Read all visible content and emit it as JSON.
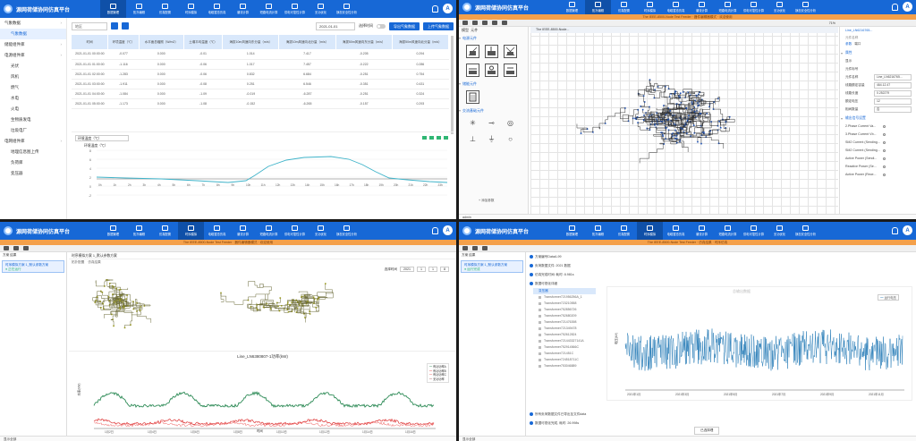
{
  "app": {
    "title": "源网荷储协同仿真平台",
    "avatar": "A",
    "nav": [
      "数据管理",
      "拓扑编辑",
      "仿真配置",
      "时序模拟",
      "电磁暂态仿真",
      "潮流计算",
      "短路电流计算",
      "供电可靠性计算",
      "无功优化",
      "静态安全性分析"
    ]
  },
  "p1": {
    "side": [
      {
        "label": "气象数据",
        "parent": true
      },
      {
        "label": "气象数据",
        "active": true
      },
      {
        "label": "储能组件库",
        "parent": true
      },
      {
        "label": "电源组件库",
        "parent": true
      },
      {
        "label": "光伏"
      },
      {
        "label": "风机"
      },
      {
        "label": "燃气"
      },
      {
        "label": "水电"
      },
      {
        "label": "火电"
      },
      {
        "label": "生物质发电"
      },
      {
        "label": "垃圾电厂"
      },
      {
        "label": "电网组件库",
        "parent": true
      },
      {
        "label": "地理信息图上传"
      },
      {
        "label": "负荷库"
      },
      {
        "label": "变压器"
      }
    ],
    "filter": "地区",
    "date": "2021-01-01",
    "toggle_label": "选择时间",
    "btn_prev": "导出气象数据",
    "btn_next": "上传气象数据",
    "headers": [
      "时间",
      "环境温度（℃）",
      "水平面总辐照（W/m2）",
      "土壤平均温度（℃）",
      "海拔10m风速向东分量（m/s）",
      "海拔10m风速向北分量（m/s）",
      "海拔50m风速向东分量（m/s）",
      "海拔50m风速向北分量（m/s）"
    ],
    "rows": [
      [
        "2021-01-01 00:00:00",
        "-0.077",
        "0.000",
        "-0.01",
        "1.014",
        "7.417",
        "-0.205",
        "0.294"
      ],
      [
        "2021-01-01 01:00:00",
        "-1.116",
        "0.000",
        "-0.06",
        "1.017",
        "7.457",
        "-0.222",
        "0.286"
      ],
      [
        "2021-01-01 02:00:00",
        "-1.283",
        "0.000",
        "-0.06",
        "0.832",
        "6.684",
        "-0.251",
        "0.754"
      ],
      [
        "2021-01-01 03:00:00",
        "-1.911",
        "0.000",
        "-0.08",
        "0.251",
        "6.546",
        "-0.351",
        "0.431"
      ],
      [
        "2021-01-01 04:00:00",
        "-1.084",
        "0.000",
        "-1.09",
        "-0.019",
        "-6.287",
        "-0.251",
        "0.324"
      ],
      [
        "2021-01-01 05:00:00",
        "-1.173",
        "0.000",
        "-1.08",
        "-0.152",
        "-6.265",
        "-0.157",
        "0.293"
      ]
    ],
    "chart_title": "环境温度（℃）",
    "chart_ylabel": "环境温度（℃）"
  },
  "p2": {
    "dev": "The IEEE-8500-Node Test Feeder · 器件编辑器模式 · 欢迎使用",
    "tab": "The IEEE-8500-Node...",
    "lib_tabs": [
      "模型",
      "元件"
    ],
    "lib_sections": [
      "电源元件",
      "储能元件",
      "交流基础元件"
    ],
    "zoom": "71%",
    "prop_tabs": [
      "参数",
      "端口"
    ],
    "props_head": "Line_LN6216765...",
    "props_sub": "元件名称",
    "props": [
      {
        "label": "显示",
        "value": ""
      },
      {
        "label": "元件标号",
        "value": ""
      },
      {
        "label": "元件名称",
        "value": "Line_LN6216765..."
      },
      {
        "label": "线路额定容量",
        "value": "464.12.47"
      },
      {
        "label": "线路长度",
        "value": "0.252279"
      },
      {
        "label": "额定电压",
        "value": "12"
      },
      {
        "label": "相间数量",
        "value": "否"
      }
    ],
    "result_items": [
      "2.Phase Current Va...",
      "3.Phase Current Vb...",
      "SM2 Current (Sending...",
      "SM2 Current (Sending...",
      "Active Power (Sendi...",
      "Reactive Power (Se...",
      "Active Power (Rece..."
    ],
    "footer": "admin",
    "add_param": "+ 添加参数",
    "grp": [
      "属性",
      "参数",
      "线路参数",
      "输出信号设置"
    ]
  },
  "p3": {
    "dev": "The IEEE-8500-Node Test Feeder · 器件编辑器模式 · 欢迎使用",
    "left_title": "方案 结果",
    "card": "时序模拟方案 1_默认参数方案",
    "card_sub": "● 正在运行",
    "top_title": "时序模拟方案 1_默认参数方案",
    "sub1": "拓扑配置",
    "sub2": "仿真结果",
    "date_label": "选择时间",
    "date_vals": [
      "2021",
      "1",
      "1",
      "8"
    ],
    "chart": {
      "title": "Line_LN6380807-1功率(kW)",
      "ylabel": "功率(kW)",
      "xlabel": "时间",
      "legend": [
        "有功功率A",
        "有功功率B",
        "有功功率C",
        "无功功率"
      ],
      "xticks": [
        "1月2日",
        "1月4日",
        "1月6日",
        "1月8日",
        "1月10日",
        "1月12日",
        "1月14日",
        "1月16日"
      ]
    },
    "status": "显示全部"
  },
  "p4": {
    "dev": "The IEEE-8500-Node Test Feeder · 仿真结果 · 时序仿真",
    "left_title": "方案 结果",
    "card": "时序模拟方案 1_默认参数方案",
    "card_sub": "● 运行完成",
    "top_title": "方案编号DataA-99",
    "lines": [
      "负荷数据文件: 2021 数据",
      "仿真完成时间: 耗时: 8.981s",
      "数据可视化详细"
    ],
    "tree_head": "变压器",
    "transformers": [
      "Transformer721956256A_1",
      "Transformer723210558",
      "Transformer752856726",
      "Transformer752680209",
      "Transformer721476398",
      "Transformer721349478",
      "Transformer752612824",
      "Transformer721443327141A",
      "Transformer752914566C",
      "Transformer721451C",
      "Transformer724518711C",
      "Transformer753046889"
    ],
    "chart": {
      "legend": "运行电压",
      "ylabel": "电压(kV)",
      "watermark": "总输出数据",
      "xticks": [
        "2021年1月",
        "2021年3月",
        "2021年5月",
        "2021年7月",
        "2021年9月",
        "2021年11月"
      ]
    },
    "foot1": "所有负荷数据文件已导出至文件data",
    "foot2": "数据可视化完成, 耗时: 26.998s",
    "btn": "已选择理"
  }
}
